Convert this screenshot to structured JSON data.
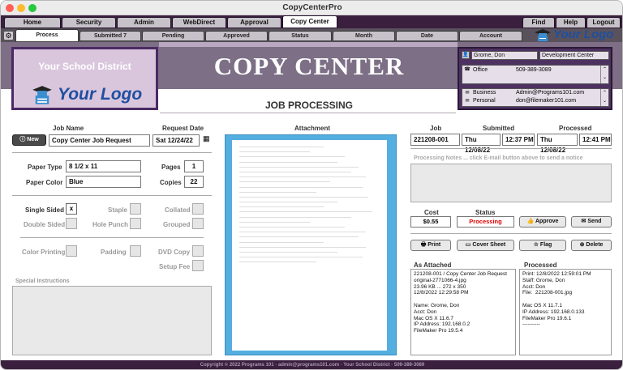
{
  "window": {
    "title": "CopyCenterPro"
  },
  "nav": {
    "tabs": [
      "Home",
      "Security",
      "Admin",
      "WebDirect",
      "Approval",
      "Copy Center"
    ],
    "right": [
      "Find",
      "Help",
      "Logout"
    ]
  },
  "subtabs": [
    "Process",
    "Submitted 7",
    "Pending",
    "Approved",
    "Status",
    "Month",
    "Date",
    "Account"
  ],
  "logo": {
    "your": "Your",
    "logo": "Logo"
  },
  "banner": {
    "district": "Your School District",
    "title": "COPY CENTER",
    "subtitle": "JOB PROCESSING"
  },
  "contact": {
    "name": "Grome, Don",
    "dept": "Development Center",
    "office_label": "Office",
    "office_phone": "509-389-3089",
    "business_label": "Business",
    "business_email": "Admin@Programs101.com",
    "personal_label": "Personal",
    "personal_email": "don@filemaker101.com"
  },
  "job": {
    "name_label": "Job Name",
    "name": "Copy Center Job Request",
    "request_date_label": "Request Date",
    "request_date": "Sat 12/24/22",
    "new_label": "New",
    "paper_type_label": "Paper Type",
    "paper_type": "8 1/2 x 11",
    "paper_color_label": "Paper Color",
    "paper_color": "Blue",
    "pages_label": "Pages",
    "pages": "1",
    "copies_label": "Copies",
    "copies": "22",
    "options": [
      {
        "label": "Single Sided",
        "value": "x"
      },
      {
        "label": "Staple",
        "value": ""
      },
      {
        "label": "Collated",
        "value": ""
      },
      {
        "label": "Double Sided",
        "value": ""
      },
      {
        "label": "Hole Punch",
        "value": ""
      },
      {
        "label": "Grouped",
        "value": ""
      },
      {
        "label": "Color Printing",
        "value": ""
      },
      {
        "label": "Padding",
        "value": ""
      },
      {
        "label": "DVD Copy",
        "value": ""
      },
      {
        "label": "Setup Fee",
        "value": ""
      }
    ],
    "special_label": "Special Instructions"
  },
  "attachment": {
    "label": "Attachment"
  },
  "status": {
    "job_label": "Job",
    "job": "221208-001",
    "submitted_label": "Submitted",
    "submitted_date": "Thu 12/08/22",
    "submitted_time": "12:37 PM",
    "processed_label": "Processed",
    "processed_date": "Thu 12/08/22",
    "processed_time": "12:41 PM",
    "notes_placeholder": "Processing Notes ... click E-mail button above to send a notice",
    "cost_label": "Cost",
    "cost": "$0.55",
    "status_label": "Status",
    "status": "Processing",
    "approve": "Approve",
    "send": "Send",
    "print": "Print",
    "cover": "Cover Sheet",
    "flag": "Flag",
    "delete": "Delete",
    "as_attached_label": "As Attached",
    "processed_col_label": "Processed",
    "as_attached": "221208-001 / Copy Center Job Request\noriginal-2771066-4.jpg\n23.96 KB ... 272 x 350\n12/8/2022 12:29:58 PM\n\nName: Grome, Don\nAcct: Don\nMac OS X 11.6.7\nIP Address: 192.168.0.2\nFileMaker Pro 19.5.4",
    "processed_text": "Print: 12/8/2022 12:59:01 PM\nStaff: Grome, Don\nAcct: Don\nFile:  221208-001.jpg\n\nMac OS X 11.7.1\nIP Address: 192.168.0.133\nFileMaker Pro 19.6.1\n----------"
  },
  "footer": "Copyright © 2022 Programs 101 · admin@programs101.com · Your School District · 509-389-3089",
  "colors": {
    "purple_dark": "#3b1f3e",
    "banner": "#7e6e86",
    "processing": "#e00000",
    "attach_bg": "#55aee0"
  }
}
